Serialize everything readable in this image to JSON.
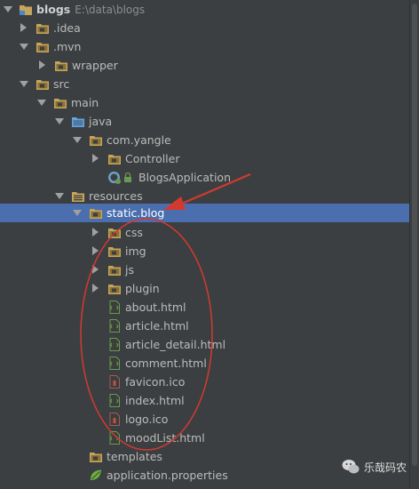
{
  "colors": {
    "background": "#3c3f41",
    "selection": "#4b6eaf",
    "folder": "#c5a55a",
    "html_file": "#6a9955",
    "annotation": "#d23a30"
  },
  "tree": {
    "root": {
      "name": "blogs",
      "path": "E:\\data\\blogs"
    },
    "items": [
      {
        "label": "blogs",
        "hint": "E:\\data\\blogs"
      },
      {
        "label": ".idea"
      },
      {
        "label": ".mvn"
      },
      {
        "label": "wrapper"
      },
      {
        "label": "src"
      },
      {
        "label": "main"
      },
      {
        "label": "java"
      },
      {
        "label": "com.yangle"
      },
      {
        "label": "Controller"
      },
      {
        "label": "BlogsApplication"
      },
      {
        "label": "resources"
      },
      {
        "label": "static.blog"
      },
      {
        "label": "css"
      },
      {
        "label": "img"
      },
      {
        "label": "js"
      },
      {
        "label": "plugin"
      },
      {
        "label": "about.html"
      },
      {
        "label": "article.html"
      },
      {
        "label": "article_detail.html"
      },
      {
        "label": "comment.html"
      },
      {
        "label": "favicon.ico"
      },
      {
        "label": "index.html"
      },
      {
        "label": "logo.ico"
      },
      {
        "label": "moodList.html"
      },
      {
        "label": "templates"
      },
      {
        "label": "application.properties"
      }
    ]
  },
  "watermark": {
    "text": "乐哉码农"
  }
}
